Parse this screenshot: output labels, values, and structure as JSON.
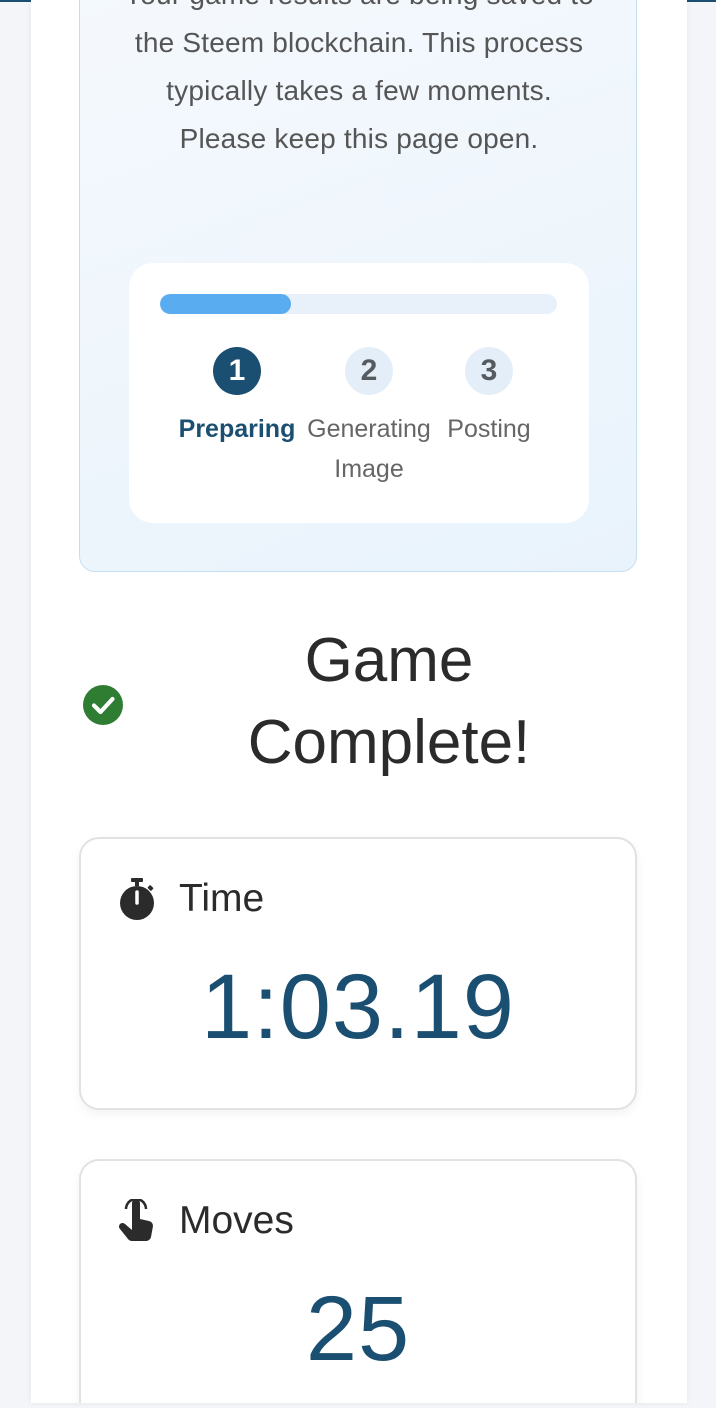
{
  "status": {
    "message": "Your game results are being saved to the Steem blockchain. This process typically takes a few moments. Please keep this page open.",
    "progress_fraction": 0.33,
    "steps": [
      {
        "number": "1",
        "label": "Preparing",
        "active": true
      },
      {
        "number": "2",
        "label": "Generating Image",
        "active": false
      },
      {
        "number": "3",
        "label": "Posting",
        "active": false
      }
    ]
  },
  "result": {
    "title": "Game Complete!",
    "icon": "check-circle-icon"
  },
  "stats": {
    "time": {
      "label": "Time",
      "value": "1:03.19",
      "icon": "stopwatch-icon"
    },
    "moves": {
      "label": "Moves",
      "value": "25",
      "icon": "pointer-hand-icon"
    }
  },
  "colors": {
    "primary": "#1b4f72",
    "progress": "#5aacf0",
    "success": "#2e7d32"
  }
}
